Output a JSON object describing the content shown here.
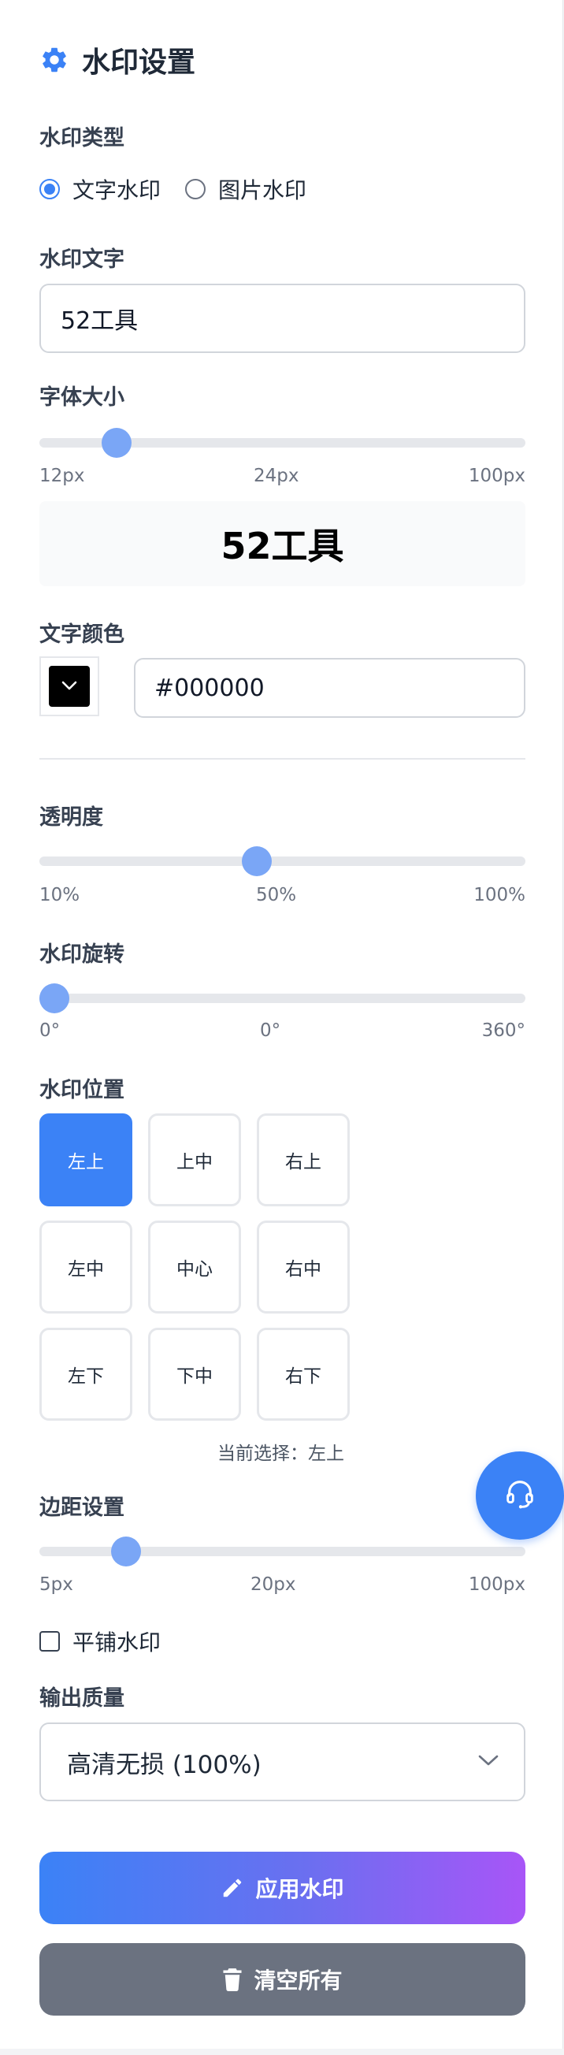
{
  "colors": {
    "accent": "#3b82f6",
    "slider_thumb": "#7aa6f6",
    "gradient_start": "#3b82f6",
    "gradient_end": "#a855f7",
    "secondary_button": "#6b7280"
  },
  "header": {
    "title": "水印设置",
    "icon": "gear-icon"
  },
  "watermark_type": {
    "label": "水印类型",
    "options": [
      {
        "label": "文字水印",
        "selected": true
      },
      {
        "label": "图片水印",
        "selected": false
      }
    ]
  },
  "watermark_text": {
    "label": "水印文字",
    "value": "52工具"
  },
  "font_size": {
    "label": "字体大小",
    "min_label": "12px",
    "current_label": "24px",
    "max_label": "100px",
    "value": 24,
    "min": 12,
    "max": 100
  },
  "preview": {
    "text": "52工具"
  },
  "text_color": {
    "label": "文字颜色",
    "value": "#000000",
    "swatch": "#000000"
  },
  "opacity": {
    "label": "透明度",
    "min_label": "10%",
    "current_label": "50%",
    "max_label": "100%",
    "value": 50,
    "min": 10,
    "max": 100
  },
  "rotation": {
    "label": "水印旋转",
    "min_label": "0°",
    "current_label": "0°",
    "max_label": "360°",
    "value": 0,
    "min": 0,
    "max": 360
  },
  "position": {
    "label": "水印位置",
    "grid": [
      [
        "左上",
        "上中",
        "右上"
      ],
      [
        "左中",
        "中心",
        "右中"
      ],
      [
        "左下",
        "下中",
        "右下"
      ]
    ],
    "selected": "左上",
    "current_label": "当前选择：左上"
  },
  "margin": {
    "label": "边距设置",
    "min_label": "5px",
    "current_label": "20px",
    "max_label": "100px",
    "value": 20,
    "min": 5,
    "max": 100
  },
  "tile": {
    "label": "平铺水印",
    "checked": false
  },
  "quality": {
    "label": "输出质量",
    "selected": "高清无损 (100%)"
  },
  "actions": {
    "apply": {
      "label": "应用水印",
      "icon": "pencil-icon"
    },
    "clear": {
      "label": "清空所有",
      "icon": "trash-icon"
    }
  },
  "support_fab": {
    "icon": "headset-icon"
  }
}
